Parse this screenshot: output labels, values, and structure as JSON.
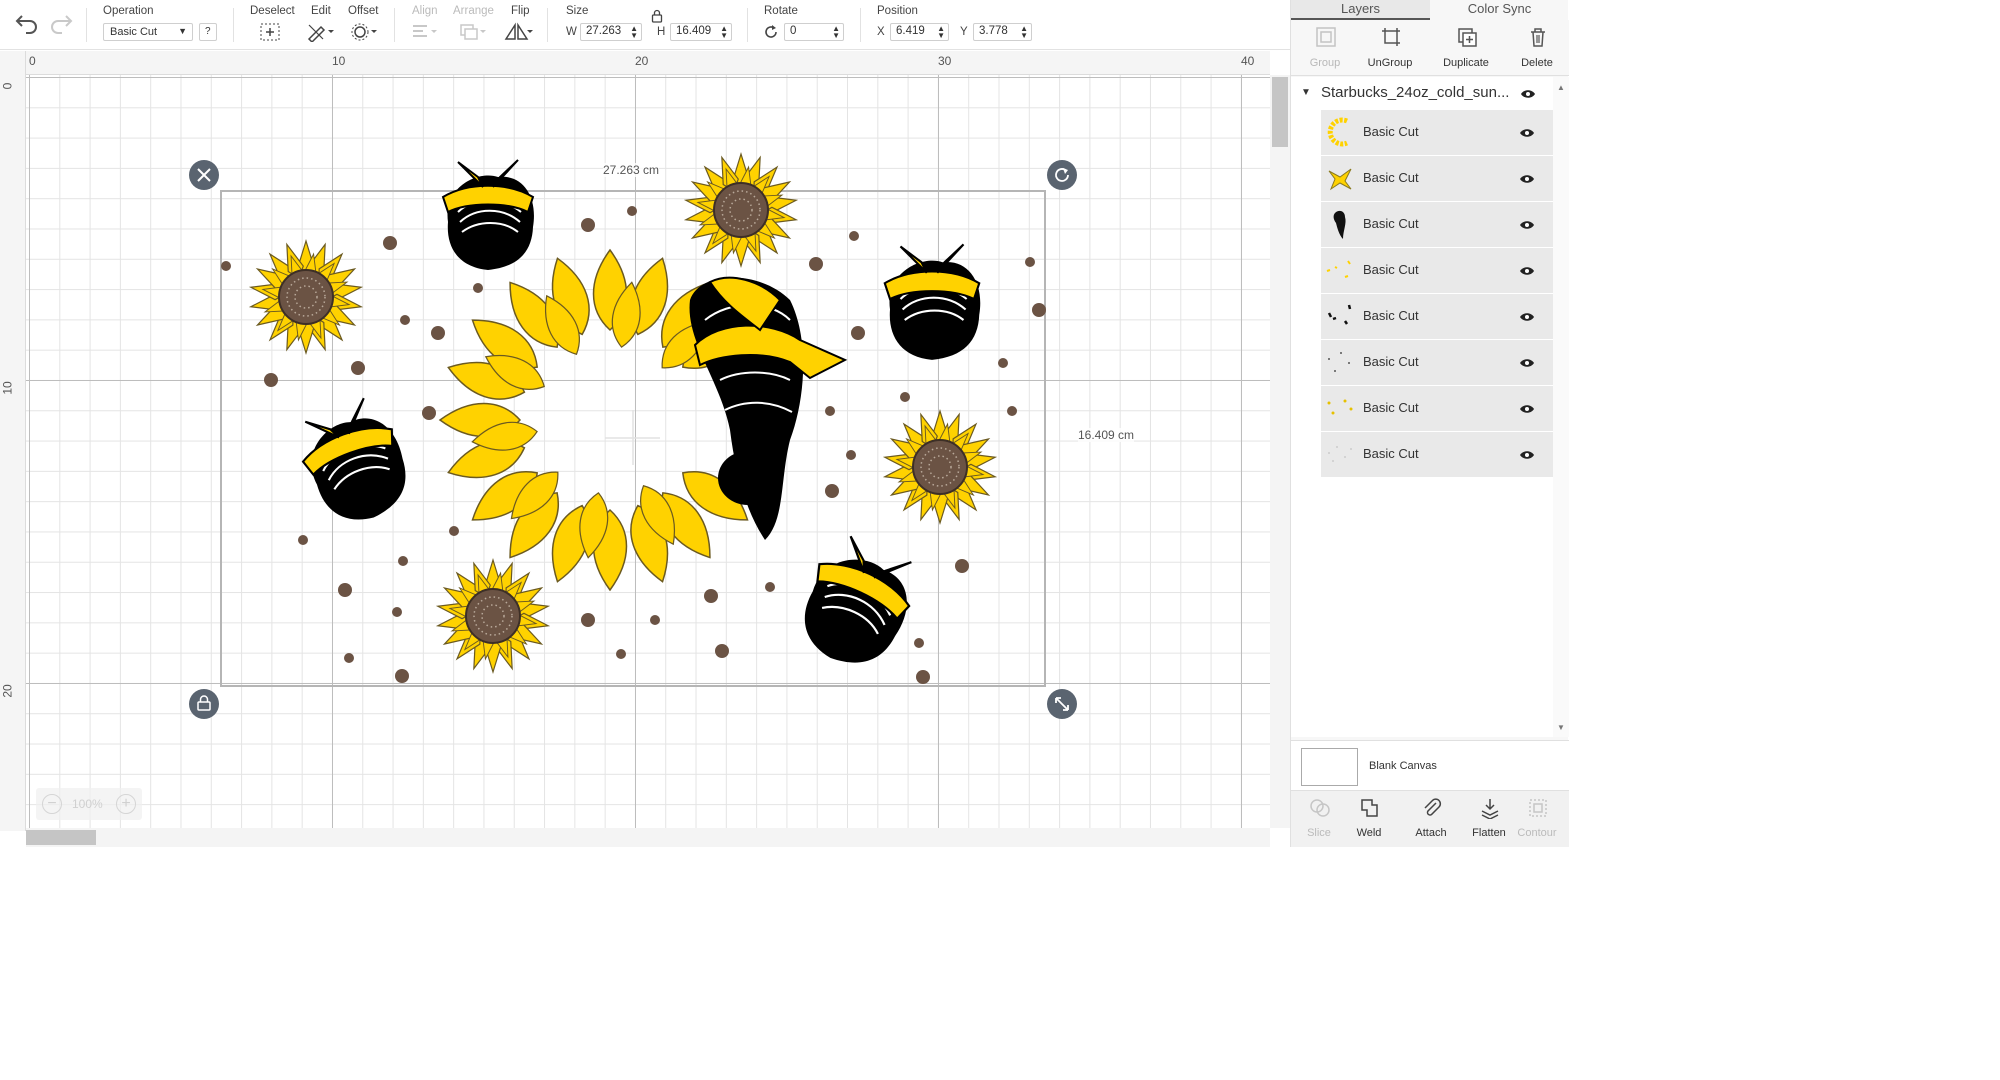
{
  "toolbar": {
    "operation_label": "Operation",
    "operation_value": "Basic Cut",
    "help_label": "?",
    "deselect_label": "Deselect",
    "edit_label": "Edit",
    "offset_label": "Offset",
    "align_label": "Align",
    "arrange_label": "Arrange",
    "flip_label": "Flip",
    "size_label": "Size",
    "size_w_label": "W",
    "size_w_value": "27.263",
    "size_h_label": "H",
    "size_h_value": "16.409",
    "rotate_label": "Rotate",
    "rotate_value": "0",
    "position_label": "Position",
    "pos_x_label": "X",
    "pos_x_value": "6.419",
    "pos_y_label": "Y",
    "pos_y_value": "3.778"
  },
  "rulers": {
    "top": [
      "0",
      "10",
      "20",
      "30",
      "40"
    ],
    "left": [
      "0",
      "10",
      "20"
    ]
  },
  "canvas": {
    "width_label": "27.263 cm",
    "height_label": "16.409 cm",
    "zoom_value": "100%",
    "zoom_minus": "−",
    "zoom_plus": "+"
  },
  "panel": {
    "tabs": [
      "Layers",
      "Color Sync"
    ],
    "actions": [
      {
        "label": "Group",
        "icon": "group-icon",
        "enabled": false
      },
      {
        "label": "UnGroup",
        "icon": "ungroup-icon",
        "enabled": true
      },
      {
        "label": "Duplicate",
        "icon": "duplicate-icon",
        "enabled": true
      },
      {
        "label": "Delete",
        "icon": "trash-icon",
        "enabled": true
      }
    ],
    "group_name": "Starbucks_24oz_cold_sun...",
    "layers": [
      {
        "name": "Basic Cut",
        "thumb": "sunflower-ring"
      },
      {
        "name": "Basic Cut",
        "thumb": "bandana"
      },
      {
        "name": "Basic Cut",
        "thumb": "mom-bun"
      },
      {
        "name": "Basic Cut",
        "thumb": "yellow-bits"
      },
      {
        "name": "Basic Cut",
        "thumb": "black-bits"
      },
      {
        "name": "Basic Cut",
        "thumb": "dots"
      },
      {
        "name": "Basic Cut",
        "thumb": "yellow-dots"
      },
      {
        "name": "Basic Cut",
        "thumb": "faint-dots"
      }
    ],
    "blank_canvas_label": "Blank Canvas",
    "bottom_actions": [
      {
        "label": "Slice",
        "icon": "slice-icon",
        "enabled": false
      },
      {
        "label": "Weld",
        "icon": "weld-icon",
        "enabled": true
      },
      {
        "label": "Attach",
        "icon": "paperclip-icon",
        "enabled": true
      },
      {
        "label": "Flatten",
        "icon": "flatten-icon",
        "enabled": true
      },
      {
        "label": "Contour",
        "icon": "contour-icon",
        "enabled": false
      }
    ]
  },
  "colors": {
    "sunflower_yellow": "#FFD200",
    "sunflower_center": "#6B5344",
    "dot_brown": "#6B5344",
    "handle_gray": "#5A6470"
  }
}
